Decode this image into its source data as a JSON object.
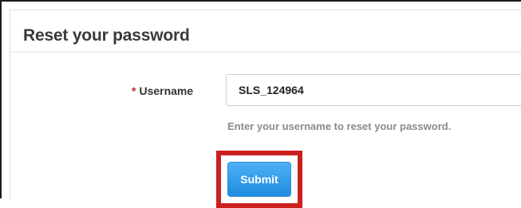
{
  "form": {
    "title": "Reset your password",
    "username_label": "Username",
    "required_marker": "*",
    "username_value": "SLS_124964",
    "help_text": "Enter your username to reset your password.",
    "submit_label": "Submit"
  },
  "colors": {
    "accent": "#2b9cec",
    "required": "#cc1f1f",
    "highlight": "#cc1f1f"
  }
}
